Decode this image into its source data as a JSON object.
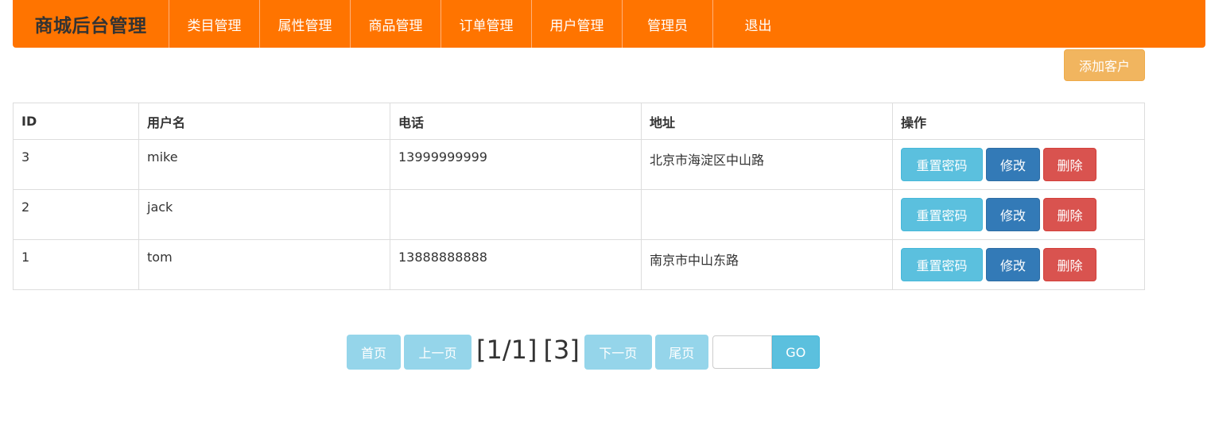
{
  "nav": {
    "brand": "商城后台管理",
    "items": [
      {
        "label": "类目管理"
      },
      {
        "label": "属性管理"
      },
      {
        "label": "商品管理"
      },
      {
        "label": "订单管理"
      },
      {
        "label": "用户管理"
      },
      {
        "label": "管理员"
      },
      {
        "label": "退出"
      }
    ]
  },
  "toolbar": {
    "add_label": "添加客户"
  },
  "table": {
    "headers": [
      "ID",
      "用户名",
      "电话",
      "地址",
      "操作"
    ],
    "rows": [
      {
        "id": "3",
        "name": "mike",
        "phone": "13999999999",
        "address": "北京市海淀区中山路"
      },
      {
        "id": "2",
        "name": "jack",
        "phone": "",
        "address": ""
      },
      {
        "id": "1",
        "name": "tom",
        "phone": "13888888888",
        "address": "南京市中山东路"
      }
    ],
    "actions": {
      "reset": "重置密码",
      "edit": "修改",
      "delete": "删除"
    }
  },
  "pagination": {
    "first": "首页",
    "prev": "上一页",
    "page_info": "[1/1]",
    "total_info": "[3]",
    "next": "下一页",
    "last": "尾页",
    "go": "GO",
    "input_value": ""
  },
  "colors": {
    "navbar": "#ff7400",
    "warning": "#f0ad4e",
    "info": "#5bc0de",
    "primary": "#337ab7",
    "danger": "#d9534f"
  }
}
